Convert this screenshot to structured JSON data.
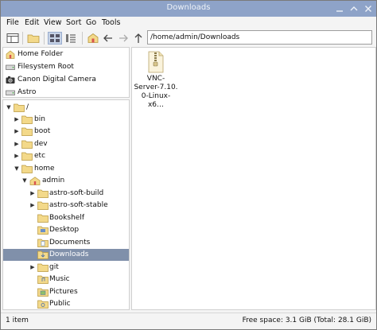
{
  "window": {
    "title": "Downloads"
  },
  "menubar": {
    "items": [
      "File",
      "Edit",
      "View",
      "Sort",
      "Go",
      "Tools"
    ]
  },
  "toolbar": {
    "path": "/home/admin/Downloads"
  },
  "places": [
    {
      "label": "Home Folder",
      "icon": "home-icon"
    },
    {
      "label": "Filesystem Root",
      "icon": "drive-icon"
    },
    {
      "label": "Canon Digital Camera",
      "icon": "camera-icon"
    },
    {
      "label": "Astro",
      "icon": "drive-icon"
    }
  ],
  "tree": [
    {
      "label": "/",
      "expanded": true
    },
    {
      "label": "bin"
    },
    {
      "label": "boot"
    },
    {
      "label": "dev"
    },
    {
      "label": "etc"
    },
    {
      "label": "home",
      "expanded": true
    },
    {
      "label": "admin",
      "expanded": true
    },
    {
      "label": "astro-soft-build"
    },
    {
      "label": "astro-soft-stable"
    },
    {
      "label": "Bookshelf"
    },
    {
      "label": "Desktop"
    },
    {
      "label": "Documents"
    },
    {
      "label": "Downloads",
      "selected": true
    },
    {
      "label": "git"
    },
    {
      "label": "Music"
    },
    {
      "label": "Pictures"
    },
    {
      "label": "Public"
    }
  ],
  "files": [
    {
      "name_lines": [
        "VNC-",
        "Server-7.10.",
        "0-Linux-x6…"
      ],
      "icon": "archive-file-icon"
    }
  ],
  "status": {
    "items": "1 item",
    "free_space": "Free space: 3.1 GiB (Total: 28.1 GiB)"
  },
  "colors": {
    "titlebar": "#8ea3c8",
    "selection": "#8090aa",
    "folder": "#f3d98a"
  }
}
